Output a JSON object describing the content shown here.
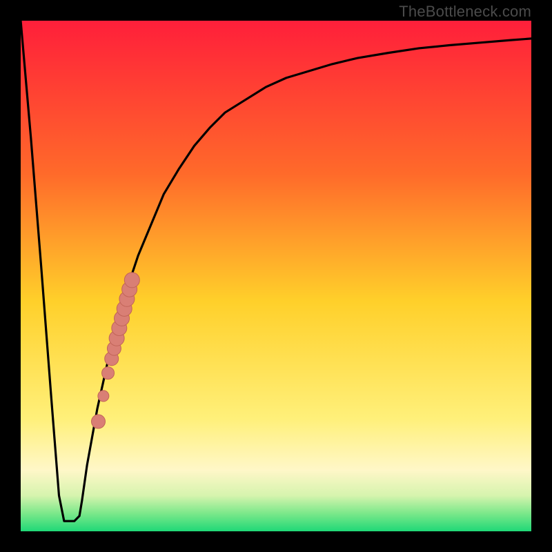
{
  "attribution": "TheBottleneck.com",
  "colors": {
    "top": "#ff1f3a",
    "upper_mid": "#ff9a2a",
    "mid": "#ffe12a",
    "lower_mid": "#fff59a",
    "base_pale": "#d7f7b8",
    "base_green": "#22e07a",
    "curve": "#000000",
    "marker_fill": "#d97f75",
    "marker_stroke": "#c16458",
    "frame": "#000000"
  },
  "chart_data": {
    "type": "line",
    "xlim": [
      0,
      1
    ],
    "ylim": [
      0,
      1
    ],
    "xlabel": "",
    "ylabel": "",
    "title": "",
    "series": [
      {
        "name": "bottleneck-curve",
        "x": [
          0.0,
          0.02,
          0.04,
          0.06,
          0.075,
          0.085,
          0.095,
          0.105,
          0.115,
          0.12,
          0.13,
          0.15,
          0.17,
          0.19,
          0.21,
          0.23,
          0.255,
          0.28,
          0.31,
          0.34,
          0.37,
          0.4,
          0.44,
          0.48,
          0.52,
          0.56,
          0.61,
          0.66,
          0.72,
          0.78,
          0.84,
          0.9,
          0.96,
          1.0
        ],
        "y": [
          1.0,
          0.77,
          0.52,
          0.26,
          0.07,
          0.02,
          0.02,
          0.02,
          0.03,
          0.06,
          0.13,
          0.24,
          0.33,
          0.41,
          0.48,
          0.54,
          0.6,
          0.66,
          0.71,
          0.755,
          0.79,
          0.82,
          0.845,
          0.87,
          0.888,
          0.9,
          0.915,
          0.927,
          0.937,
          0.946,
          0.952,
          0.957,
          0.962,
          0.965
        ]
      }
    ],
    "markers": [
      {
        "x": 0.152,
        "y": 0.215,
        "r": 10
      },
      {
        "x": 0.162,
        "y": 0.265,
        "r": 8
      },
      {
        "x": 0.171,
        "y": 0.31,
        "r": 9
      },
      {
        "x": 0.178,
        "y": 0.338,
        "r": 10
      },
      {
        "x": 0.183,
        "y": 0.358,
        "r": 10
      },
      {
        "x": 0.188,
        "y": 0.378,
        "r": 11
      },
      {
        "x": 0.193,
        "y": 0.398,
        "r": 11
      },
      {
        "x": 0.198,
        "y": 0.417,
        "r": 11
      },
      {
        "x": 0.203,
        "y": 0.436,
        "r": 11
      },
      {
        "x": 0.208,
        "y": 0.455,
        "r": 11
      },
      {
        "x": 0.213,
        "y": 0.474,
        "r": 11
      },
      {
        "x": 0.218,
        "y": 0.492,
        "r": 11
      }
    ],
    "gradient_stops": [
      {
        "offset": 0.0,
        "color": "#ff1f3a"
      },
      {
        "offset": 0.3,
        "color": "#ff6a2a"
      },
      {
        "offset": 0.55,
        "color": "#ffd02a"
      },
      {
        "offset": 0.78,
        "color": "#fff07a"
      },
      {
        "offset": 0.88,
        "color": "#fff7c8"
      },
      {
        "offset": 0.93,
        "color": "#d6f4ae"
      },
      {
        "offset": 0.965,
        "color": "#7be88a"
      },
      {
        "offset": 1.0,
        "color": "#1fd877"
      }
    ]
  }
}
